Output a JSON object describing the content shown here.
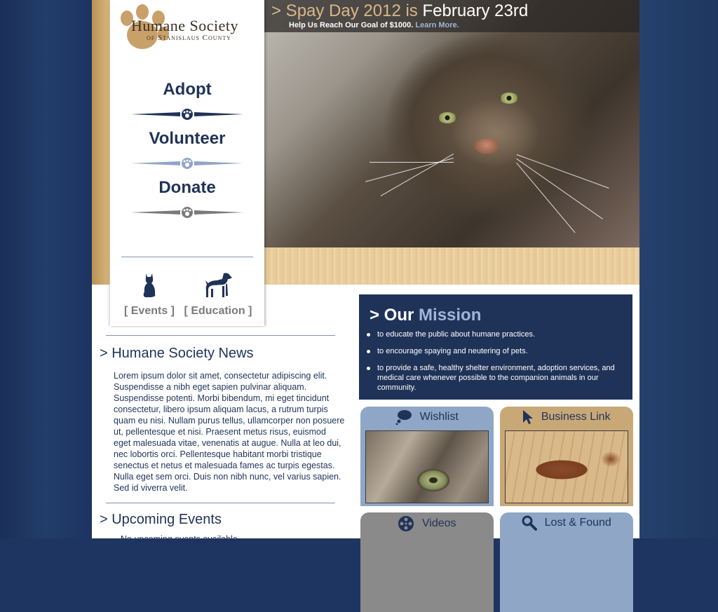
{
  "org": {
    "name_line1": "Humane Society",
    "name_line2": "of Stanislaus County"
  },
  "nav": {
    "items": [
      {
        "label": "Adopt"
      },
      {
        "label": "Volunteer"
      },
      {
        "label": "Donate"
      }
    ],
    "quick_links": [
      {
        "label": "[ Events ]",
        "icon": "cat-icon"
      },
      {
        "label": "[ Education ]",
        "icon": "dog-icon"
      }
    ]
  },
  "hero": {
    "prefix": "> Spay Day 2012 is ",
    "highlight": "February 23rd",
    "subtitle": "Help Us Reach Our Goal of $1000.",
    "link": "Learn More."
  },
  "news": {
    "title": "> Humane Society News",
    "body": "Lorem ipsum dolor sit amet, consectetur adipiscing elit. Suspendisse a nibh eget sapien pulvinar aliquam. Suspendisse potenti. Morbi bibendum, mi eget tincidunt consectetur, libero ipsum aliquam lacus, a rutrum turpis quam eu nisi. Nullam purus tellus, ullamcorper non posuere ut, pellentesque et nisi. Praesent metus risus, euismod eget malesuada vitae, venenatis at augue. Nulla at leo dui, nec lobortis orci. Pellentesque habitant morbi tristique senectus et netus et malesuada fames ac turpis egestas. Nulla eget sem orci. Duis non nibh nunc, vel varius sapien. Sed id viverra velit."
  },
  "events": {
    "title": "> Upcoming Events",
    "first_line": "No upcoming events available"
  },
  "mission": {
    "title_prefix": "> Our ",
    "title_accent": "Mission",
    "items": [
      "to educate the public about humane practices.",
      "to encourage spaying and neutering of pets.",
      "to provide a safe, healthy shelter environment, adoption services, and medical care whenever possible to the companion animals in our community."
    ]
  },
  "tiles": [
    {
      "label": "Wishlist",
      "icon": "thought-bubble-icon",
      "color": "#8fa6c6"
    },
    {
      "label": "Business Link",
      "icon": "cursor-icon",
      "color": "#c9a878"
    },
    {
      "label": "Videos",
      "icon": "film-reel-icon",
      "color": "#8a8a8a"
    },
    {
      "label": "Lost & Found",
      "icon": "magnifier-icon",
      "color": "#8fa6c6"
    }
  ],
  "colors": {
    "navy": "#1f3358",
    "accent_blue": "#9fb6d8",
    "tan": "#d9b78a",
    "background": "#1d3560"
  }
}
